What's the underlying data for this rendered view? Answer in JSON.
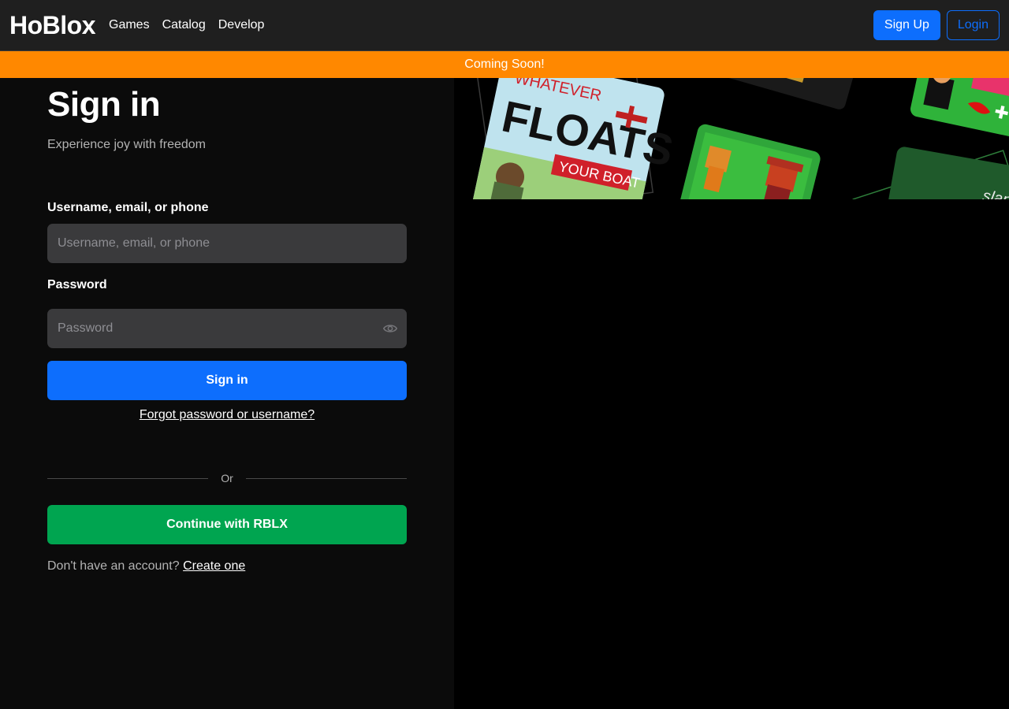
{
  "nav": {
    "brand": "HoBlox",
    "links": [
      "Games",
      "Catalog",
      "Develop"
    ],
    "signup_label": "Sign Up",
    "login_label": "Login"
  },
  "banner": {
    "text": "Coming Soon!"
  },
  "signin": {
    "title": "Sign in",
    "subtitle": "Experience joy with freedom",
    "username_label": "Username, email, or phone",
    "username_placeholder": "Username, email, or phone",
    "password_label": "Password",
    "password_placeholder": "Password",
    "submit_label": "Sign in",
    "forgot_label": "Forgot password or username?",
    "divider_label": "Or",
    "alt_label": "Continue with RBLX",
    "no_account_text": "Don't have an account?",
    "create_label": "Create one"
  },
  "collage": {
    "card1_line1": "WHATEVER",
    "card1_line2": "FLOATS",
    "card1_line3": "YOUR BOAT",
    "card3_text": "slap"
  },
  "colors": {
    "primary": "#0d6efd",
    "banner": "#ff8800",
    "green": "#00a550"
  }
}
